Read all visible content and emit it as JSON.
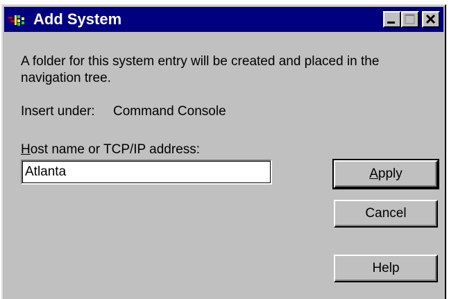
{
  "window": {
    "title": "Add System",
    "colors": {
      "titlebar": "#000080",
      "face": "#c0c0c0"
    }
  },
  "title_buttons": {
    "minimize_icon": "minimize-icon",
    "maximize_icon": "maximize-icon",
    "close_icon": "close-icon"
  },
  "dialog": {
    "description_line1": "A folder for this system entry will be created and placed in the",
    "description_line2": "navigation tree.",
    "insert_under_label": "Insert under:",
    "insert_under_value": "Command Console",
    "host_label_accel": "H",
    "host_label_rest": "ost name or TCP/IP address:",
    "host_value": "Atlanta"
  },
  "buttons": {
    "apply_accel": "A",
    "apply_rest": "pply",
    "cancel": "Cancel",
    "help": "Help"
  }
}
